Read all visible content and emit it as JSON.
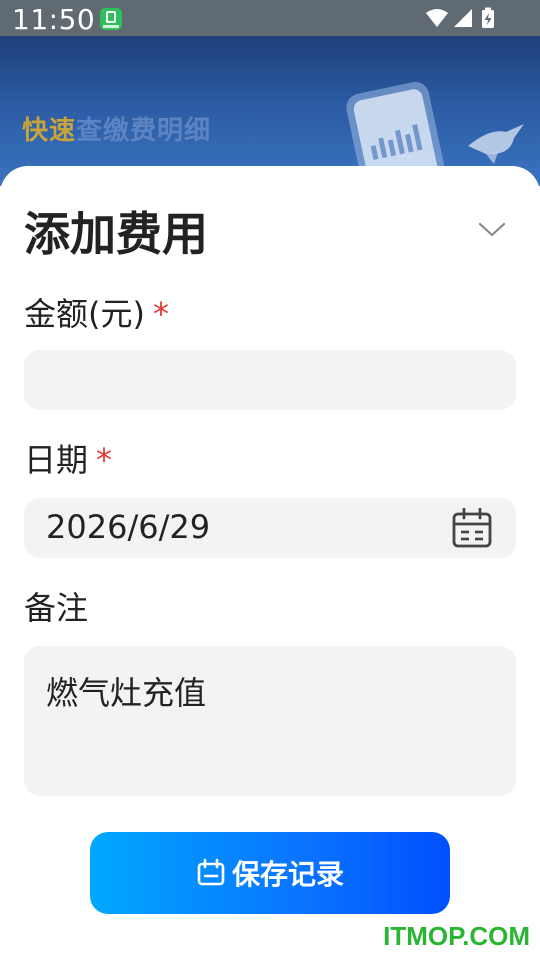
{
  "status_bar": {
    "time": "11:50",
    "app_icon": "green-app-notification-icon",
    "icons": [
      "wifi-icon",
      "signal-icon",
      "battery-charging-icon"
    ]
  },
  "banner": {
    "text_highlight": "快速",
    "text_rest": "查缴费明细"
  },
  "sheet": {
    "title": "添加费用",
    "collapse_icon": "chevron-down-icon"
  },
  "form": {
    "amount": {
      "label": "金额(元)",
      "required_mark": "*",
      "value": "",
      "placeholder": ""
    },
    "date": {
      "label": "日期",
      "required_mark": "*",
      "value": "2026/6/29",
      "icon": "calendar-icon"
    },
    "note": {
      "label": "备注",
      "value": "燃气灶充值"
    }
  },
  "actions": {
    "save_label": "保存记录",
    "save_icon": "save-record-icon"
  },
  "watermark": "ITMOP.COM",
  "colors": {
    "required": "#e53935",
    "button_start": "#00a8ff",
    "button_end": "#0050ff",
    "input_bg": "#f3f3f4",
    "watermark": "#2bb534",
    "banner_highlight": "#c8a43a"
  }
}
